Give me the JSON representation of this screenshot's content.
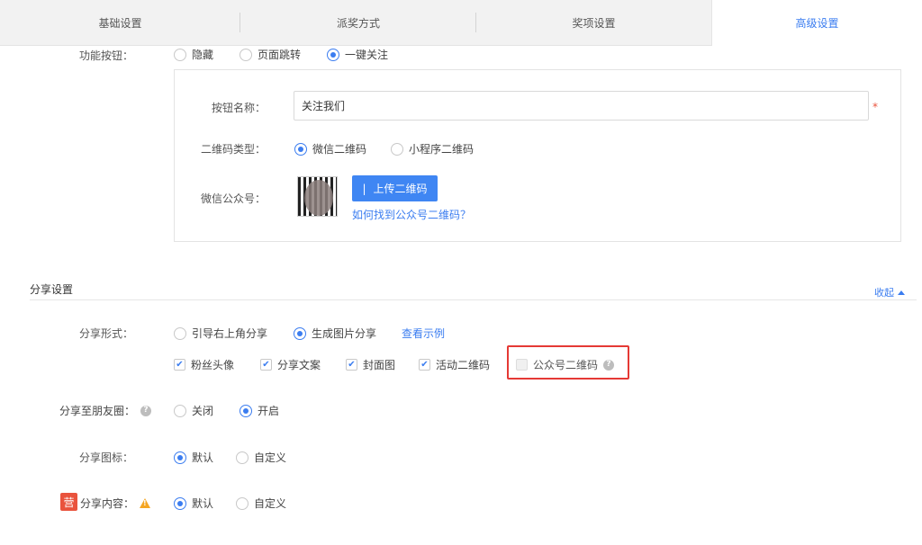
{
  "tabs": [
    {
      "label": "基础设置"
    },
    {
      "label": "派奖方式"
    },
    {
      "label": "奖项设置"
    },
    {
      "label": "高级设置"
    }
  ],
  "function_button": {
    "label": "功能按钮：",
    "options": [
      {
        "label": "隐藏",
        "selected": false
      },
      {
        "label": "页面跳转",
        "selected": false
      },
      {
        "label": "一键关注",
        "selected": true
      }
    ]
  },
  "follow_card": {
    "button_name_label": "按钮名称：",
    "button_name_value": "关注我们",
    "required_mark": "*",
    "qr_type_label": "二维码类型：",
    "qr_type_options": [
      {
        "label": "微信二维码",
        "selected": true
      },
      {
        "label": "小程序二维码",
        "selected": false
      }
    ],
    "official_account_label": "微信公众号：",
    "upload_button": "上传二维码",
    "help_link": "如何找到公众号二维码？"
  },
  "share_settings": {
    "title": "分享设置",
    "collapse": "收起",
    "form_label": "分享形式：",
    "form_options": [
      {
        "label": "引导右上角分享",
        "selected": false
      },
      {
        "label": "生成图片分享",
        "selected": true
      }
    ],
    "example_link": "查看示例",
    "elements": [
      {
        "label": "粉丝头像",
        "checked": true
      },
      {
        "label": "分享文案",
        "checked": true
      },
      {
        "label": "封面图",
        "checked": true
      },
      {
        "label": "活动二维码",
        "checked": true
      },
      {
        "label": "公众号二维码",
        "checked": false,
        "disabled": true
      }
    ],
    "moments_label": "分享至朋友圈：",
    "moments_options": [
      {
        "label": "关闭",
        "selected": false
      },
      {
        "label": "开启",
        "selected": true
      }
    ],
    "icon_label": "分享图标：",
    "icon_options": [
      {
        "label": "默认",
        "selected": true
      },
      {
        "label": "自定义",
        "selected": false
      }
    ],
    "content_badge": "营",
    "content_label": "分享内容：",
    "content_options": [
      {
        "label": "默认",
        "selected": true
      },
      {
        "label": "自定义",
        "selected": false
      }
    ]
  },
  "colors": {
    "accent": "#3b7df0",
    "highlight_border": "#e53935",
    "badge": "#e9533d",
    "warning": "#f5a623"
  }
}
